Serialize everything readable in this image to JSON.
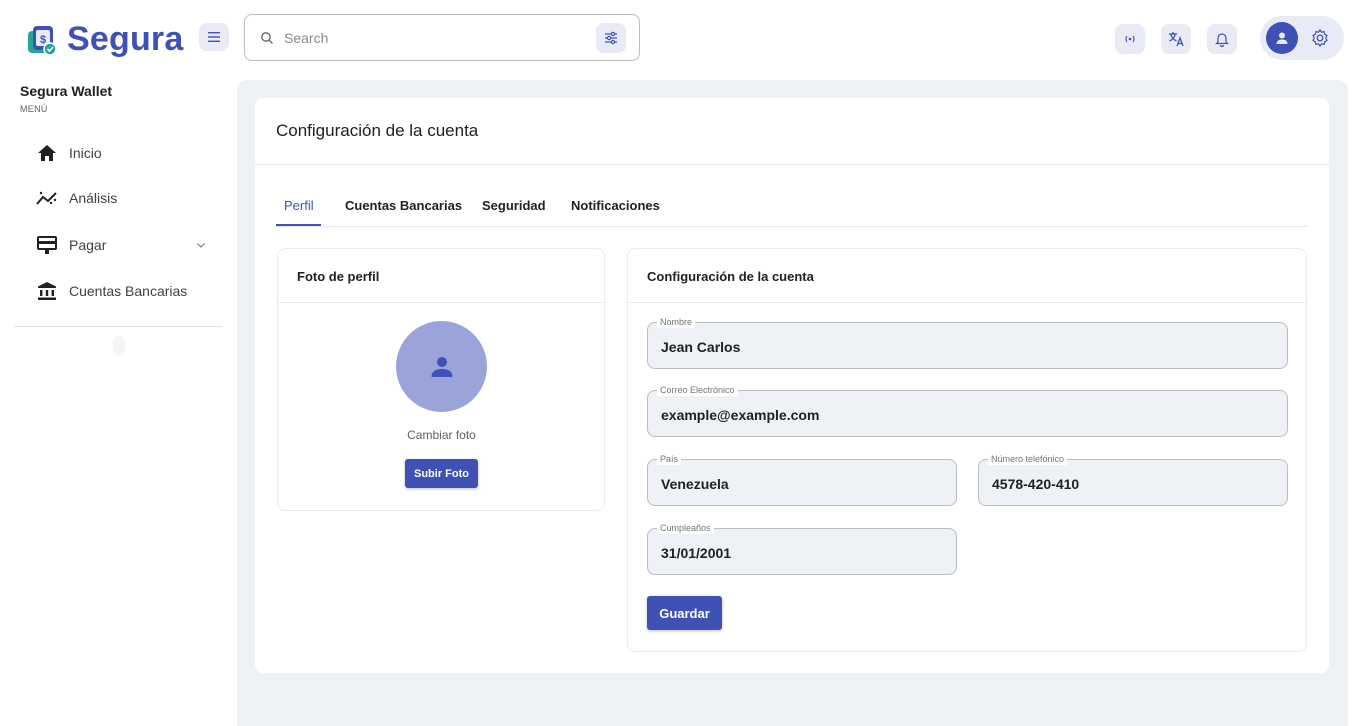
{
  "app": {
    "name": "Segura",
    "brand_color": "#3f51b5"
  },
  "header": {
    "search_placeholder": "Search",
    "icons": [
      "menu-icon",
      "search-icon",
      "filter-icon",
      "broadcast-icon",
      "translate-icon",
      "bell-icon",
      "user-icon",
      "gear-icon"
    ]
  },
  "sidebar": {
    "title": "Segura Wallet",
    "subtitle": "MENÚ",
    "items": [
      {
        "label": "Inicio",
        "icon": "home-icon"
      },
      {
        "label": "Análisis",
        "icon": "analytics-icon"
      },
      {
        "label": "Pagar",
        "icon": "payment-icon",
        "has_submenu": true
      },
      {
        "label": "Cuentas Bancarias",
        "icon": "bank-icon"
      }
    ]
  },
  "main": {
    "title": "Configuración de la cuenta",
    "tabs": [
      {
        "label": "Perfil",
        "active": true
      },
      {
        "label": "Cuentas Bancarias"
      },
      {
        "label": "Seguridad"
      },
      {
        "label": "Notificaciones"
      }
    ],
    "photo_card": {
      "title": "Foto de perfil",
      "change_label": "Cambiar foto",
      "upload_label": "Subir Foto"
    },
    "account_card": {
      "title": "Configuración de la cuenta",
      "fields": {
        "nombre": {
          "label": "Nombre",
          "value": "Jean Carlos"
        },
        "correo": {
          "label": "Correo Electrónico",
          "value": "example@example.com"
        },
        "pais": {
          "label": "País",
          "value": "Venezuela"
        },
        "telefono": {
          "label": "Número telefónico",
          "value": "4578-420-410"
        },
        "cumpleanos": {
          "label": "Cumpleaños",
          "value": "31/01/2001"
        }
      },
      "save_label": "Guardar"
    }
  }
}
